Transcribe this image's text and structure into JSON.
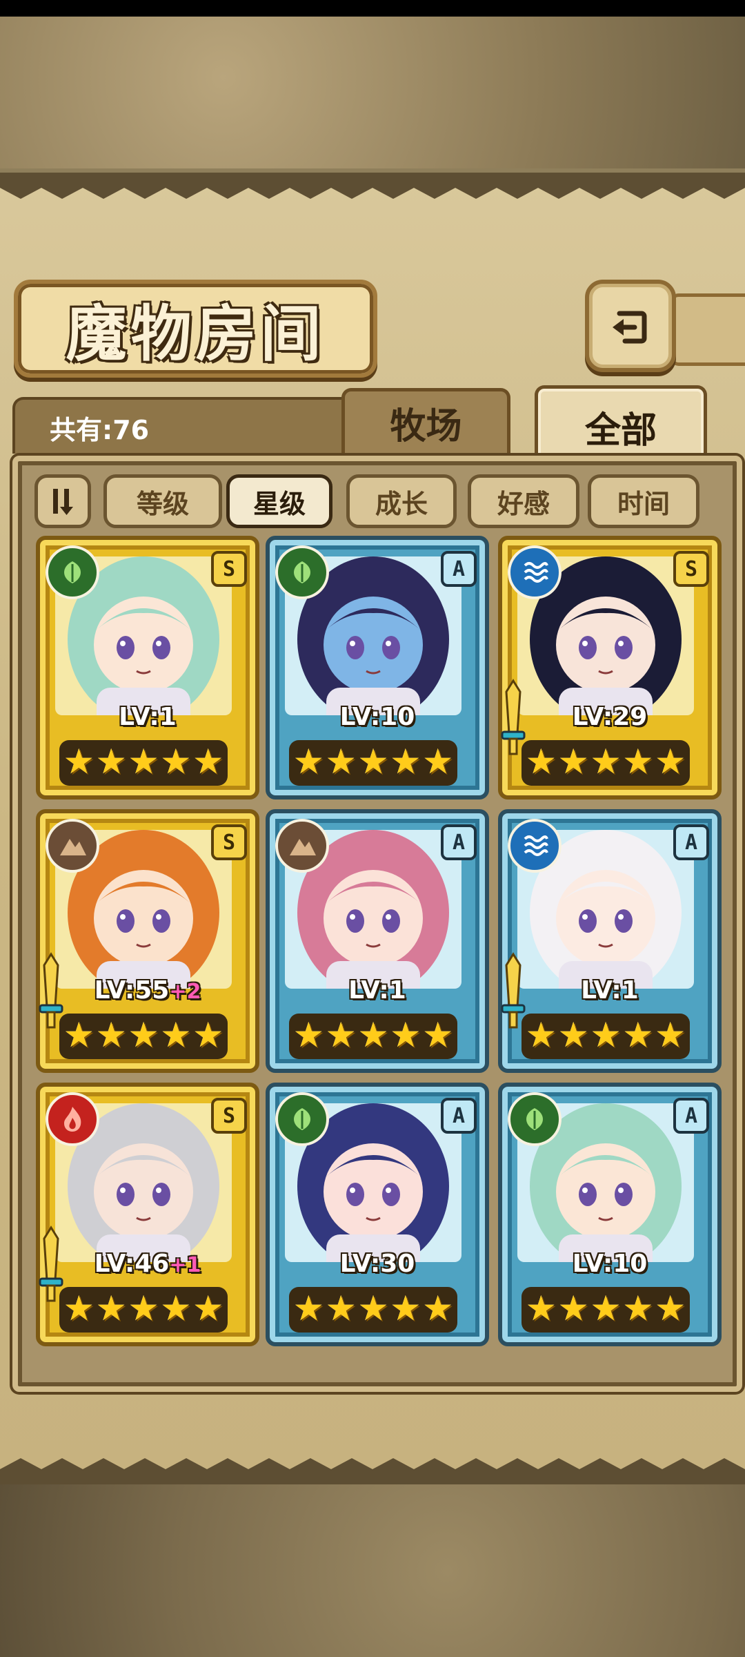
{
  "screen": {
    "title": "魔物房间",
    "count_text": "共有:76"
  },
  "tabs": {
    "ranch": "牧场",
    "all": "全部"
  },
  "sort_buttons": [
    {
      "label": "等级",
      "active": false
    },
    {
      "label": "星级",
      "active": true
    },
    {
      "label": "成长",
      "active": false
    },
    {
      "label": "好感",
      "active": false
    },
    {
      "label": "时间",
      "active": false
    }
  ],
  "cards": [
    {
      "level": "LV:1",
      "bonus": "",
      "rank": "S",
      "element": "leaf",
      "frame": "gold",
      "stars": 5,
      "equipped_weapon": false,
      "hair": "#9fd8c4",
      "skin": "#fbe6d6"
    },
    {
      "level": "LV:10",
      "bonus": "",
      "rank": "A",
      "element": "leaf",
      "frame": "blue",
      "stars": 5,
      "equipped_weapon": false,
      "hair": "#2d2a5c",
      "skin": "#7fb5e6"
    },
    {
      "level": "LV:29",
      "bonus": "",
      "rank": "S",
      "element": "water",
      "frame": "gold",
      "stars": 5,
      "equipped_weapon": true,
      "hair": "#1b1c36",
      "skin": "#f8e4d9"
    },
    {
      "level": "LV:55",
      "bonus": "+2",
      "rank": "S",
      "element": "earth",
      "frame": "gold",
      "stars": 5,
      "equipped_weapon": true,
      "hair": "#e37b2b",
      "skin": "#fbe2cc"
    },
    {
      "level": "LV:1",
      "bonus": "",
      "rank": "A",
      "element": "earth",
      "frame": "blue",
      "stars": 5,
      "equipped_weapon": false,
      "hair": "#d77b98",
      "skin": "#fbe2d8"
    },
    {
      "level": "LV:1",
      "bonus": "",
      "rank": "A",
      "element": "water",
      "frame": "blue",
      "stars": 5,
      "equipped_weapon": true,
      "hair": "#f3f1f4",
      "skin": "#fcebe2"
    },
    {
      "level": "LV:46",
      "bonus": "+1",
      "rank": "S",
      "element": "fire",
      "frame": "gold",
      "stars": 5,
      "equipped_weapon": true,
      "hair": "#cfcfd3",
      "skin": "#f7e3d8"
    },
    {
      "level": "LV:30",
      "bonus": "",
      "rank": "A",
      "element": "leaf",
      "frame": "blue",
      "stars": 5,
      "equipped_weapon": false,
      "hair": "#33387f",
      "skin": "#fbe0da"
    },
    {
      "level": "LV:10",
      "bonus": "",
      "rank": "A",
      "element": "leaf",
      "frame": "blue",
      "stars": 5,
      "equipped_weapon": false,
      "hair": "#9fd8c4",
      "skin": "#fbe6d6"
    }
  ]
}
